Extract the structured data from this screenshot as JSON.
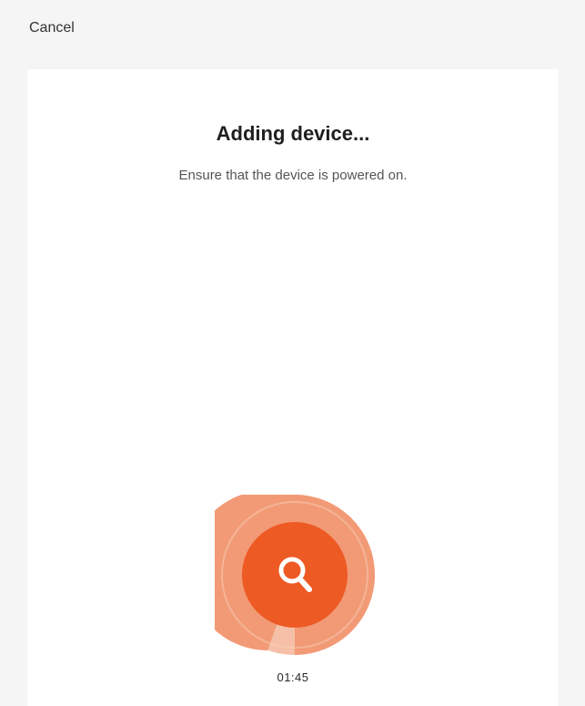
{
  "header": {
    "cancel_label": "Cancel"
  },
  "main": {
    "title": "Adding device...",
    "subtitle": "Ensure that the device is powered on.",
    "timer": "01:45",
    "icon": "search-icon"
  },
  "colors": {
    "accent": "#ee5a24",
    "ring_light": "#f7b59b",
    "ring_mid": "#f29a76",
    "background": "#f5f5f5",
    "card": "#ffffff"
  }
}
